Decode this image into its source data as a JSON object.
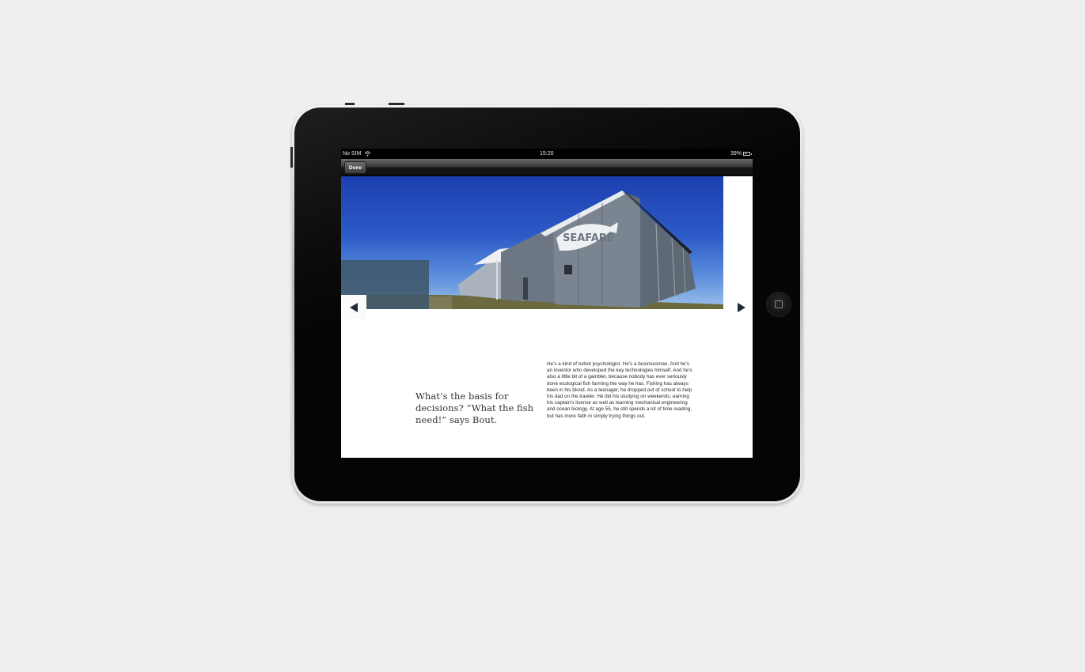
{
  "status_bar": {
    "carrier": "No SIM",
    "time": "15:20",
    "battery": "39%"
  },
  "nav_bar": {
    "done_label": "Done"
  },
  "article": {
    "hero_image": {
      "sign_text": "SEAFARE"
    },
    "pull_quote": "What’s the basis for decisions? “What the fish need!” says Bout.",
    "body": "He’s a kind of turbot psychologist. He’s a businessman. And he’s an inventor who developed the key technologies himself. And he’s also a little bit of a gambler, because nobody has ever seriously done ecological fish farming the way he has. Fishing has always been in his blood. As a teenager, he dropped out of school to help his dad on the trawler. He did his studying on weekends, earning his captain’s license as well as learning mechanical engineering and ocean biology. At age 55, he still spends a lot of time reading, but has more faith in simply trying things out."
  },
  "navigation": {
    "prev_icon": "triangle-left-icon",
    "next_icon": "triangle-right-icon"
  },
  "colors": {
    "background": "#efefef",
    "bezel": "#050505",
    "overlay": "#3e566a",
    "arrow": "#1e2a36"
  }
}
